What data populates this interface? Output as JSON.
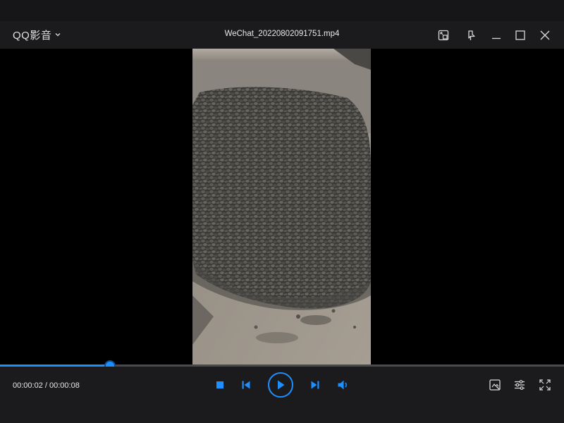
{
  "app": {
    "menu_label": "QQ影音",
    "file_title": "WeChat_20220802091751.mp4"
  },
  "playback": {
    "time_text": "00:00:02 / 00:00:08",
    "current_seconds": 2,
    "total_seconds": 8,
    "progress_fraction": 0.195,
    "state": "paused"
  },
  "colors": {
    "accent": "#1e8fff",
    "titlebar_bg": "#1b1b1d",
    "video_bg": "#000000",
    "track": "#4a4a4c"
  },
  "icons": {
    "mini_mode": "picture-in-picture-icon",
    "pin": "pin-icon",
    "minimize": "minimize-icon",
    "maximize": "maximize-icon",
    "close": "close-icon",
    "stop": "stop-icon",
    "previous": "previous-icon",
    "play": "play-icon",
    "next": "next-icon",
    "volume": "volume-icon",
    "screenshot": "screenshot-icon",
    "settings": "settings-icon",
    "fullscreen": "fullscreen-icon"
  }
}
